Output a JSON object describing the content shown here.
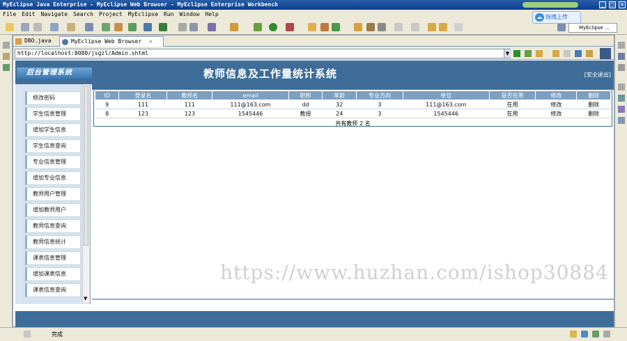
{
  "window": {
    "title": "MyEclipse Java Enterprise - MyEclipse Web Browser - MyEclipse Enterprise Workbench"
  },
  "menu": [
    "File",
    "Edit",
    "Navigate",
    "Search",
    "Project",
    "MyEclipse",
    "Run",
    "Window",
    "Help"
  ],
  "overlay": {
    "upload_label": "拖拽上传"
  },
  "perspective": {
    "label": "MyEclipse ..."
  },
  "tabs": [
    {
      "label": "DBO.java",
      "icon": "java-file-icon"
    },
    {
      "label": "MyEclipse Web Browser",
      "icon": "globe-icon"
    }
  ],
  "browser": {
    "url": "http://localhost:8080/jsgzl/Admin.shtml"
  },
  "app": {
    "logo": "后台管理系统",
    "title": "教师信息及工作量统计系统",
    "logout": "[安全退出]"
  },
  "sidebar": {
    "items": [
      "修改密码",
      "学生信息管理",
      "增加学生信息",
      "学生信息查询",
      "专业信息管理",
      "增加专业信息",
      "教师用户管理",
      "增加教师用户",
      "教师信息查询",
      "教师信息统计",
      "课表信息管理",
      "增加课表信息",
      "课表信息查询"
    ]
  },
  "table": {
    "headers": [
      "ID",
      "登录名",
      "教师名",
      "email",
      "职称",
      "年龄",
      "专业方向",
      "单位",
      "是否在用",
      "修改",
      "删除"
    ],
    "rows": [
      [
        "9",
        "111",
        "111",
        "111@163.com",
        "dd",
        "32",
        "3",
        "111@163.com",
        "在用",
        "修改",
        "删除"
      ],
      [
        "8",
        "123",
        "123",
        "1545446",
        "教授",
        "24",
        "3",
        "1545446",
        "在用",
        "修改",
        "删除"
      ]
    ],
    "footer": "共有教师 2 名"
  },
  "watermark": "https://www.huzhan.com/ishop30884",
  "status": {
    "text": "完成"
  },
  "colors": {
    "header": "#3e6d99",
    "table_header": "#7d9fc0",
    "sidebar": "#d7e3ef"
  }
}
